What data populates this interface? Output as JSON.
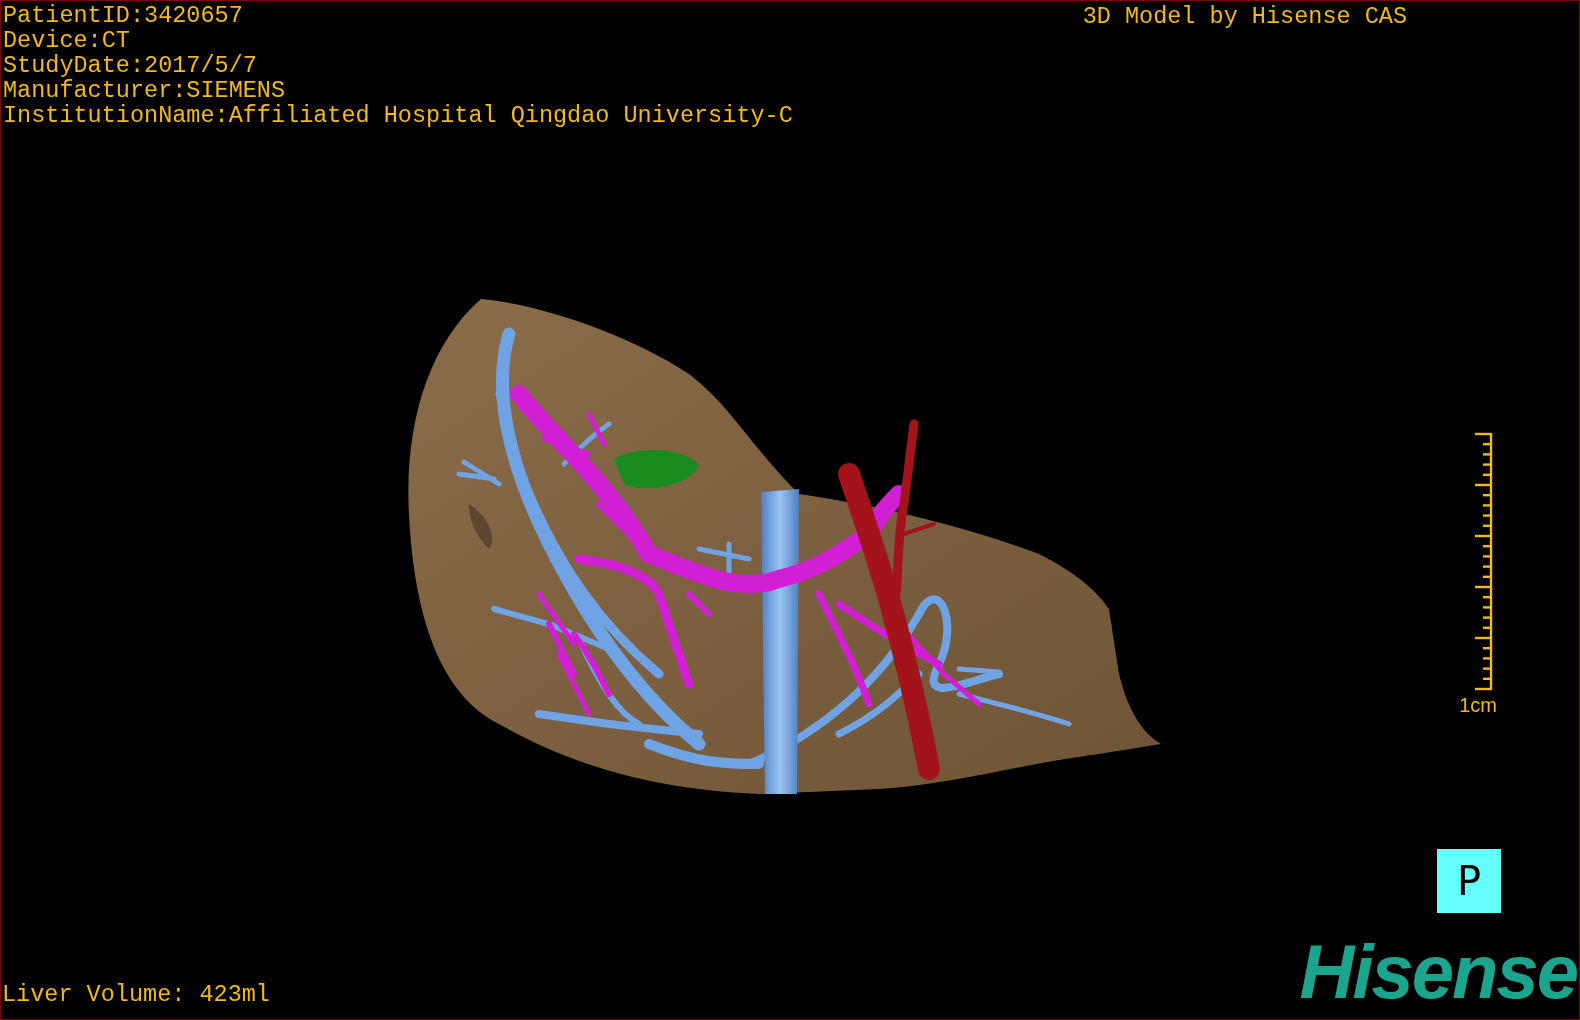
{
  "study_info": [
    "PatientID:3420657",
    "Device:CT",
    "StudyDate:2017/5/7",
    "Manufacturer:SIEMENS",
    "InstitutionName:Affiliated Hospital Qingdao University-C"
  ],
  "title": "3D Model by Hisense CAS",
  "scale_bar": {
    "label": "1cm"
  },
  "orientation": {
    "label": "P"
  },
  "liver_volume": "Liver Volume: 423ml",
  "logo": "Hisense"
}
